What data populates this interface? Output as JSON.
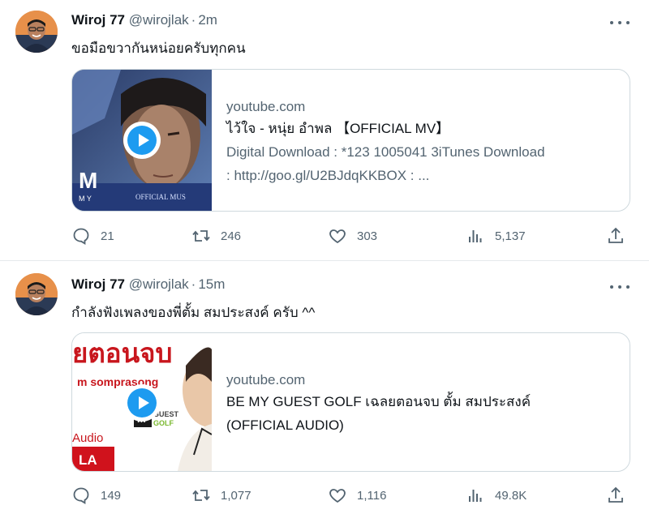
{
  "tweets": [
    {
      "author": {
        "name": "Wiroj 77",
        "handle": "@wirojlak",
        "time": "2m"
      },
      "text": "ขอมือขวากันหน่อยครับทุกคน",
      "card": {
        "domain": "youtube.com",
        "title": "ไว้ใจ - หนุ่ย อำพล 【OFFICIAL MV】",
        "description": [
          "Digital Download : *123 1005041 3iTunes Download",
          ": http://goo.gl/U2BJdqKKBOX : ..."
        ],
        "thumbnail": {
          "logo_text": "M",
          "caption": "OFFICIAL MUS",
          "sub": "M Y"
        }
      },
      "stats": {
        "replies": "21",
        "retweets": "246",
        "likes": "303",
        "views": "5,137"
      }
    },
    {
      "author": {
        "name": "Wiroj 77",
        "handle": "@wirojlak",
        "time": "15m"
      },
      "text": "กำลังฟังเพลงของพี่ตั้ม สมประสงค์ ครับ ^^",
      "card": {
        "domain": "youtube.com",
        "title": "BE MY GUEST GOLF เฉลยตอนจบ ตั้ม สมประสงค์",
        "description": [
          "(OFFICIAL AUDIO)"
        ],
        "thumbnail": {
          "title_text": "ยตอนจบ",
          "artist": "m somprasong",
          "badge1": "GUEST",
          "badge2": "GOLF",
          "audio": "Audio",
          "label": "LA"
        }
      },
      "stats": {
        "replies": "149",
        "retweets": "1,077",
        "likes": "1,116",
        "views": "49.8K"
      }
    }
  ],
  "icons": {
    "reply": "reply-icon",
    "retweet": "retweet-icon",
    "like": "heart-icon",
    "views": "views-icon",
    "share": "share-icon",
    "more": "more-icon",
    "play": "play-icon"
  },
  "colors": {
    "accent": "#1d9bf0",
    "muted": "#536471",
    "text": "#0f1419",
    "border": "#cfd9de"
  }
}
